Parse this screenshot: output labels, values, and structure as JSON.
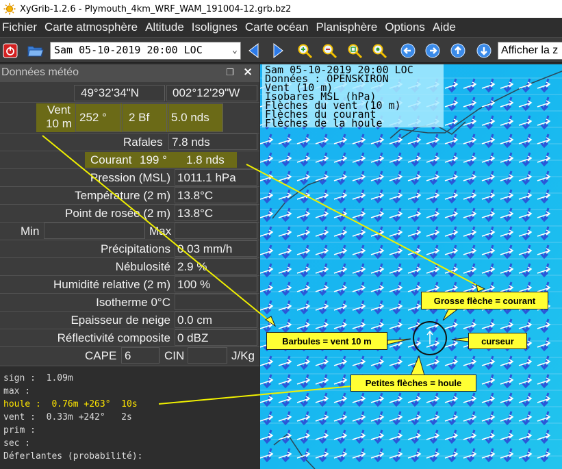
{
  "window": {
    "title": "XyGrib-1.2.6 - Plymouth_4km_WRF_WAM_191004-12.grb.bz2"
  },
  "menu": [
    "Fichier",
    "Carte atmosphère",
    "Altitude",
    "Isolignes",
    "Carte océan",
    "Planisphère",
    "Options",
    "Aide"
  ],
  "toolbar": {
    "date_value": "Sam 05-10-2019 20:00 LOC",
    "afficher_label": "Afficher la z"
  },
  "panel": {
    "title": "Données météo",
    "lat": "49°32'34\"N",
    "lon": "002°12'29\"W",
    "vent_label": "Vent 10 m",
    "vent_dir": "252 °",
    "vent_bf": "2 Bf",
    "vent_speed": "5.0  nds",
    "rafales_label": "Rafales",
    "rafales_value": "7.8  nds",
    "courant_label": "Courant",
    "courant_dir": "199 °",
    "courant_speed": "1.8  nds",
    "rows": [
      {
        "label": "Pression (MSL)",
        "value": "1011.1 hPa"
      },
      {
        "label": "Température (2 m)",
        "value": "13.8°C"
      },
      {
        "label": "Point de rosée (2 m)",
        "value": "13.8°C"
      }
    ],
    "min_label": "Min",
    "max_label": "Max",
    "rows2": [
      {
        "label": "Précipitations",
        "value": "0.03 mm/h"
      },
      {
        "label": "Nébulosité",
        "value": "2.9 %"
      },
      {
        "label": "Humidité relative (2 m)",
        "value": "100 %"
      },
      {
        "label": "Isotherme 0°C",
        "value": ""
      },
      {
        "label": "Epaisseur de neige",
        "value": "0.0 cm"
      },
      {
        "label": "Réflectivité composite",
        "value": "0 dBZ"
      }
    ],
    "cape_label": "CAPE",
    "cape_value": "6",
    "cin_label": "CIN",
    "cin_unit": "J/Kg"
  },
  "console": [
    "sign :  1.09m",
    "max :",
    "houle :  0.76m +263°  10s",
    "vent :  0.33m +242°   2s",
    "prim :",
    "sec :",
    "Déferlantes (probabilité):"
  ],
  "legend": [
    "Sam 05-10-2019 20:00 LOC",
    "Données : OPENSKIRON",
    "Vent (10 m)",
    "Isobares MSL (hPa)",
    "Flèches du vent (10 m)",
    "Flèches du courant",
    "Flèches de la houle"
  ],
  "callouts": {
    "courant": "Grosse flèche = courant",
    "vent": "Barbules = vent 10 m",
    "curseur": "curseur",
    "houle": "Petites flèches = houle"
  },
  "colors": {
    "highlight": "#6b6a17",
    "callout": "#ffff33",
    "map_sea": "#17b5f0",
    "wind_arrow": "#2b57d8",
    "swell_arrow": "#ffffff"
  }
}
